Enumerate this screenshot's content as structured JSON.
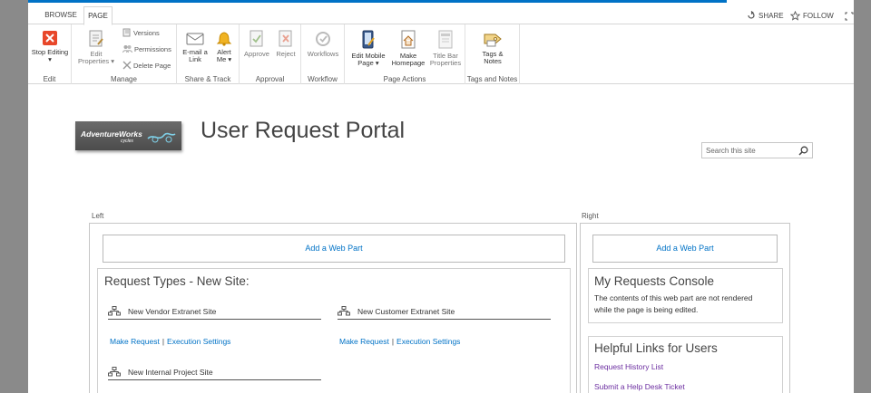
{
  "tabs": [
    "BROWSE",
    "PAGE"
  ],
  "actions": {
    "share": "SHARE",
    "follow": "FOLLOW"
  },
  "ribbon": {
    "edit": {
      "label": "Edit",
      "stop_editing": "Stop Editing"
    },
    "manage": {
      "label": "Manage",
      "edit_properties_1": "Edit",
      "edit_properties_2": "Properties",
      "versions": "Versions",
      "permissions": "Permissions",
      "delete_page": "Delete Page"
    },
    "share_track": {
      "label": "Share & Track",
      "email_1": "E-mail a",
      "email_2": "Link",
      "alert_1": "Alert",
      "alert_2": "Me"
    },
    "approval": {
      "label": "Approval",
      "approve": "Approve",
      "reject": "Reject"
    },
    "workflow": {
      "label": "Workflow",
      "workflows": "Workflows"
    },
    "page_actions": {
      "label": "Page Actions",
      "edit_mobile_1": "Edit Mobile",
      "edit_mobile_2": "Page",
      "make_homepage_1": "Make",
      "make_homepage_2": "Homepage",
      "title_bar_1": "Title Bar",
      "title_bar_2": "Properties"
    },
    "tags_notes": {
      "label": "Tags and Notes",
      "tags_1": "Tags &",
      "tags_2": "Notes"
    }
  },
  "logo": {
    "text": "AdventureWorks",
    "sub": "cycles"
  },
  "site_title": "User Request Portal",
  "search": {
    "placeholder": "Search this site"
  },
  "left_zone": {
    "label": "Left",
    "add_web_part": "Add a Web Part",
    "webpart_title": "Request Types - New Site:",
    "items": [
      {
        "name": "New Vendor Extranet Site",
        "make_request": "Make Request",
        "execution_settings": "Execution Settings"
      },
      {
        "name": "New Customer Extranet Site",
        "make_request": "Make Request",
        "execution_settings": "Execution Settings"
      },
      {
        "name": "New Internal Project Site"
      }
    ]
  },
  "right_zone": {
    "label": "Right",
    "add_web_part": "Add a Web Part",
    "console": {
      "title": "My Requests Console",
      "text_1": "The contents of this web part are not rendered",
      "text_2": "while the page is being edited."
    },
    "helpful": {
      "title": "Helpful Links for Users",
      "links": [
        "Request History List",
        "Submit a Help Desk Ticket"
      ]
    }
  },
  "colors": {
    "accent": "#0072c6",
    "visited_link": "#6b2da0",
    "stop_editing": "#e8472a"
  }
}
